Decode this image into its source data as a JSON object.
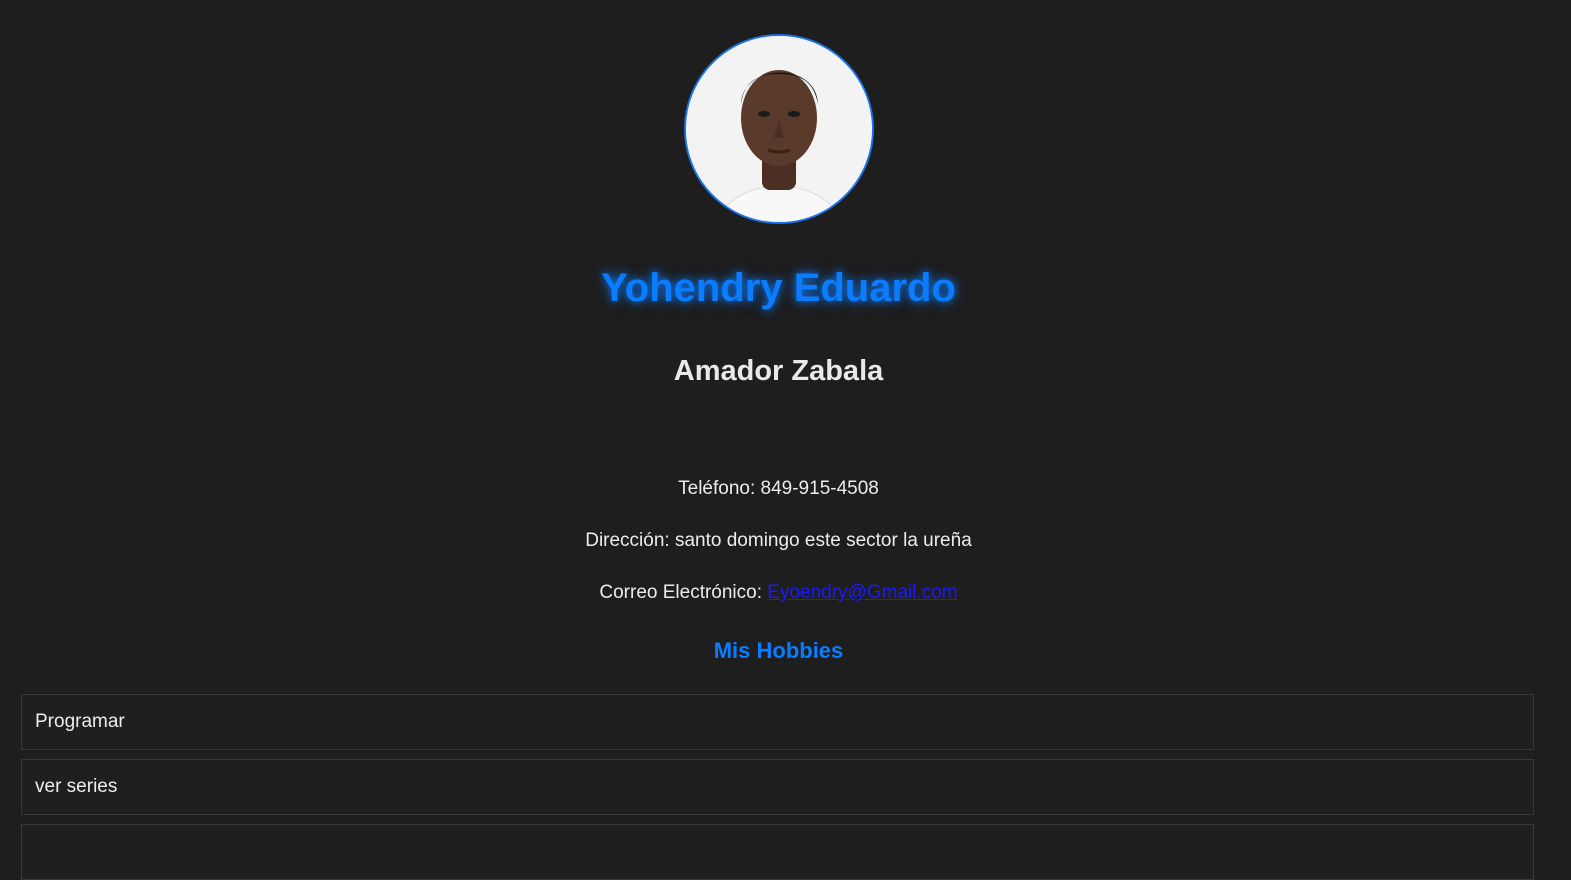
{
  "profile": {
    "first_name": "Yohendry Eduardo",
    "last_name": "Amador Zabala",
    "accent_color": "#0a7cff"
  },
  "contact": {
    "phone_label": "Teléfono: ",
    "phone": "849-915-4508",
    "address_label": "Dirección: ",
    "address": "santo domingo este sector la ureña",
    "email_label": "Correo Electrónico: ",
    "email": "Eyoendry@Gmail.com"
  },
  "hobbies": {
    "title": "Mis Hobbies",
    "items": [
      "Programar",
      "ver series",
      ""
    ]
  }
}
